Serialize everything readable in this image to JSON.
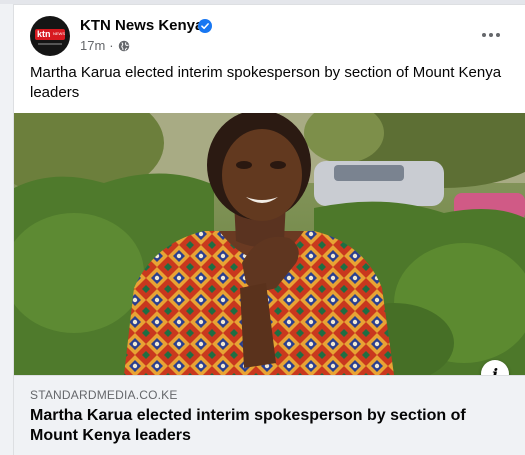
{
  "post": {
    "page_name": "KTN News Kenya",
    "avatar": {
      "logo_text": "ktn",
      "logo_subtext": "NEWS"
    },
    "timestamp": "17m",
    "separator": "·",
    "caption": "Martha Karua elected interim spokesperson by section of Mount Kenya leaders",
    "icons": {
      "verified": "verified-badge-icon",
      "privacy": "globe-icon",
      "more": "more-options-icon",
      "info": "info-icon"
    }
  },
  "link_preview": {
    "domain": "STANDARDMEDIA.CO.KE",
    "title": "Martha Karua elected interim spokesperson by section of Mount Kenya leaders",
    "info_glyph": "i"
  },
  "colors": {
    "verified_blue": "#1877f2",
    "secondary_text": "#65676b",
    "preview_bg": "#f0f2f5"
  }
}
